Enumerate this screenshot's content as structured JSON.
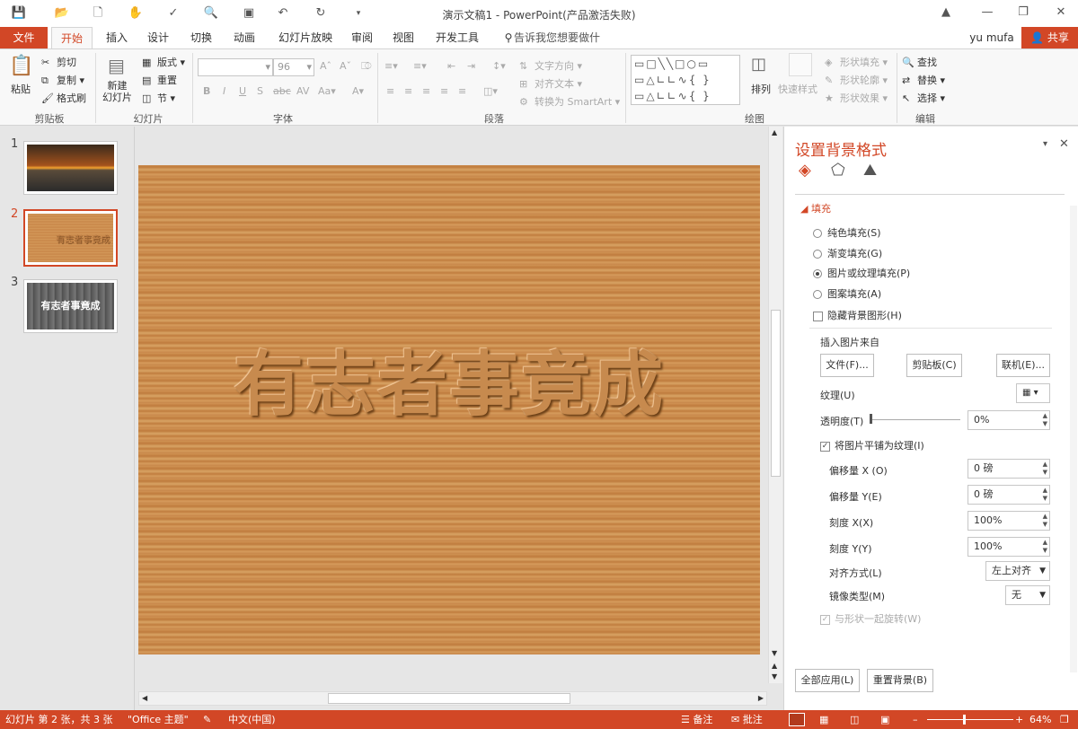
{
  "window": {
    "title": "演示文稿1 - PowerPoint(产品激活失败)"
  },
  "tabs": {
    "file": "文件",
    "home": "开始",
    "insert": "插入",
    "design": "设计",
    "transitions": "切换",
    "animations": "动画",
    "slideshow": "幻灯片放映",
    "review": "审阅",
    "view": "视图",
    "developer": "开发工具",
    "tellme": "告诉我您想要做什么...",
    "user": "yu mufa",
    "share": "共享"
  },
  "ribbon": {
    "clipboard": {
      "label": "剪贴板",
      "paste": "粘贴",
      "cut": "剪切",
      "copy": "复制",
      "format_painter": "格式刷"
    },
    "slides": {
      "label": "幻灯片",
      "new_slide": "新建\n幻灯片",
      "layout": "版式",
      "reset": "重置",
      "section": "节"
    },
    "font": {
      "label": "字体",
      "font_size": "96"
    },
    "paragraph": {
      "label": "段落",
      "text_direction": "文字方向",
      "align_text": "对齐文本",
      "smartart": "转换为 SmartArt"
    },
    "drawing": {
      "label": "绘图",
      "arrange": "排列",
      "quick_styles": "快速样式",
      "shape_fill": "形状填充",
      "shape_outline": "形状轮廓",
      "shape_effects": "形状效果"
    },
    "editing": {
      "label": "编辑",
      "find": "查找",
      "replace": "替换",
      "select": "选择"
    }
  },
  "thumbnails": [
    {
      "num": "1"
    },
    {
      "num": "2",
      "text": "有志者事竟成"
    },
    {
      "num": "3",
      "text": "有志者事竟成"
    }
  ],
  "slide": {
    "text": "有志者事竟成"
  },
  "format_pane": {
    "title": "设置背景格式",
    "section_fill": "填充",
    "options": {
      "solid": "纯色填充(S)",
      "gradient": "渐变填充(G)",
      "picture": "图片或纹理填充(P)",
      "pattern": "图案填充(A)",
      "hide_bg": "隐藏背景图形(H)"
    },
    "insert_from": "插入图片来自",
    "btn_file": "文件(F)...",
    "btn_clipboard": "剪贴板(C)",
    "btn_online": "联机(E)...",
    "texture_label": "纹理(U)",
    "transparency_label": "透明度(T)",
    "transparency_value": "0%",
    "tile_label": "将图片平铺为纹理(I)",
    "offset_x_label": "偏移量 X (O)",
    "offset_x_value": "0 磅",
    "offset_y_label": "偏移量 Y(E)",
    "offset_y_value": "0 磅",
    "scale_x_label": "刻度 X(X)",
    "scale_x_value": "100%",
    "scale_y_label": "刻度 Y(Y)",
    "scale_y_value": "100%",
    "alignment_label": "对齐方式(L)",
    "alignment_value": "左上对齐",
    "mirror_label": "镜像类型(M)",
    "mirror_value": "无",
    "rotate_label": "与形状一起旋转(W)",
    "apply_all": "全部应用(L)",
    "reset_bg": "重置背景(B)"
  },
  "status": {
    "slide_info": "幻灯片 第 2 张，共 3 张",
    "theme": "\"Office 主题\"",
    "language": "中文(中国)",
    "notes": "备注",
    "comments": "批注",
    "zoom": "64%"
  },
  "colors": {
    "accent": "#d24726"
  }
}
